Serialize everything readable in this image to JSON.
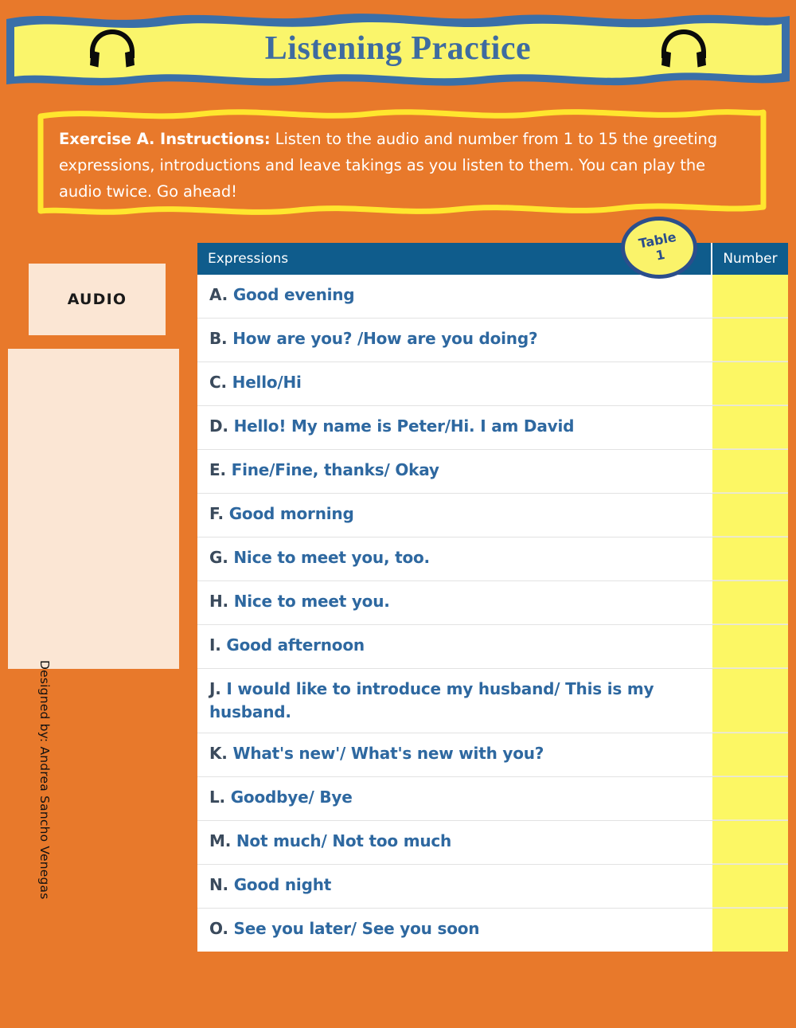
{
  "page": {
    "background_color": "#E8792B"
  },
  "header": {
    "title": "Listening Practice",
    "banner_fill": "#FAF56B",
    "banner_border": "#3A6FA8",
    "title_color": "#3E6BA0",
    "left_icon": "headphones-icon",
    "right_icon": "headphones-icon"
  },
  "instructions": {
    "lead": "Exercise A. Instructions:",
    "body": " Listen to the audio and number from 1 to 15 the greeting expressions, introductions and leave takings as you listen to them. You can play the audio twice. Go ahead!",
    "border_color": "#FFE62E",
    "text_color": "#FFFFFF"
  },
  "audio": {
    "label": "AUDIO",
    "panel_color": "#FBE6D4"
  },
  "credit": {
    "text": "Designed by: Andrea Sancho Venegas"
  },
  "badge": {
    "line1": "Table",
    "line2": "1",
    "fill": "#FAF36A",
    "border": "#2B4E8C"
  },
  "table": {
    "header_color": "#0F5C8C",
    "number_cell_color": "#FCF764",
    "expression_text_color": "#2E68A0",
    "columns": [
      "Expressions",
      "Number"
    ],
    "rows": [
      {
        "letter": "A.",
        "text": "Good evening",
        "number": ""
      },
      {
        "letter": "B.",
        "text": "How are you? /How are you doing?",
        "number": ""
      },
      {
        "letter": "C.",
        "text": "Hello/Hi",
        "number": ""
      },
      {
        "letter": "D.",
        "text": "Hello! My name is Peter/Hi. I am David",
        "number": ""
      },
      {
        "letter": "E.",
        "text": "Fine/Fine, thanks/ Okay",
        "number": ""
      },
      {
        "letter": "F.",
        "text": "Good morning",
        "number": ""
      },
      {
        "letter": "G.",
        "text": "Nice to meet you, too.",
        "number": ""
      },
      {
        "letter": "H.",
        "text": "Nice to meet you.",
        "number": ""
      },
      {
        "letter": "I.",
        "text": "Good afternoon",
        "number": ""
      },
      {
        "letter": "J.",
        "text": "I would like to introduce my husband/ This is my husband.",
        "number": ""
      },
      {
        "letter": "K.",
        "text": "What's new'/ What's new with you?",
        "number": ""
      },
      {
        "letter": "L.",
        "text": "Goodbye/ Bye",
        "number": ""
      },
      {
        "letter": "M.",
        "text": "Not much/ Not too much",
        "number": ""
      },
      {
        "letter": "N.",
        "text": "Good night",
        "number": ""
      },
      {
        "letter": "O.",
        "text": "See you later/ See you soon",
        "number": ""
      }
    ]
  }
}
